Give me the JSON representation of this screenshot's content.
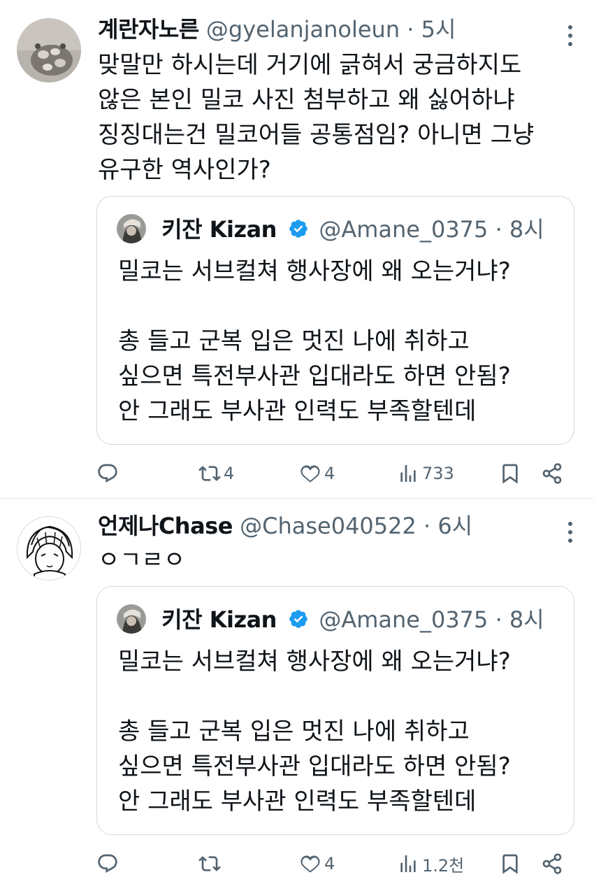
{
  "tweets": [
    {
      "name": "계란자노른",
      "handle": "@gyelanjanoleun",
      "time": "5시",
      "text": "맞말만 하시는데 거기에 긁혀서 궁금하지도\n않은 본인 밀코 사진 첨부하고 왜 싫어하냐\n징징대는건 밀코어들 공통점임? 아니면 그냥\n유구한 역사인가?",
      "quote": {
        "name": "키잔 Kizan",
        "handle": "@Amane_0375",
        "time": "8시",
        "text": "밀코는 서브컬쳐 행사장에 왜 오는거냐?\n\n총 들고 군복 입은 멋진 나에 취하고\n싶으면 특전부사관 입대라도 하면 안됨?\n안 그래도 부사관 인력도 부족할텐데"
      },
      "actions": {
        "replies": "",
        "retweets": "4",
        "likes": "4",
        "views": "733"
      }
    },
    {
      "name": "언제나Chase",
      "handle": "@Chase040522",
      "time": "6시",
      "text": "ㅇㄱㄹㅇ",
      "quote": {
        "name": "키잔 Kizan",
        "handle": "@Amane_0375",
        "time": "8시",
        "text": "밀코는 서브컬쳐 행사장에 왜 오는거냐?\n\n총 들고 군복 입은 멋진 나에 취하고\n싶으면 특전부사관 입대라도 하면 안됨?\n안 그래도 부사관 인력도 부족할텐데"
      },
      "actions": {
        "replies": "",
        "retweets": "",
        "likes": "4",
        "views": "1.2천"
      }
    }
  ],
  "colors": {
    "text": "#0f1419",
    "secondary": "#536471",
    "border": "#cfd9de",
    "verified": "#1d9bf0",
    "divider": "#eff3f4"
  },
  "icons": [
    "reply-icon",
    "retweet-icon",
    "like-icon",
    "views-icon",
    "bookmark-icon",
    "share-icon",
    "more-icon",
    "verified-badge-icon"
  ]
}
